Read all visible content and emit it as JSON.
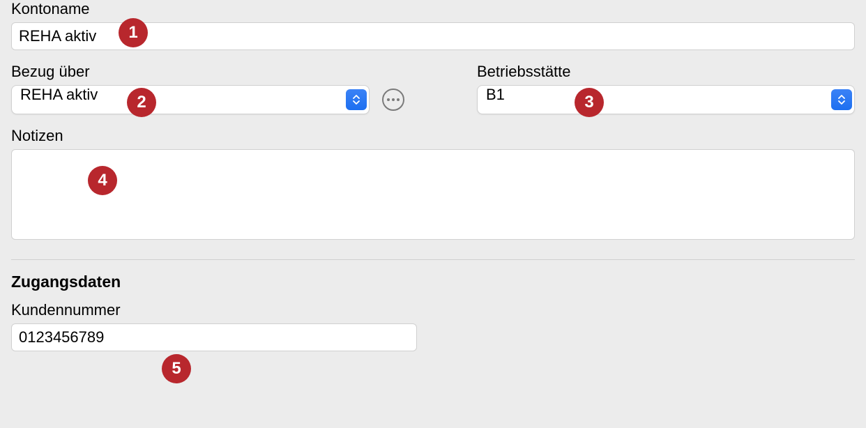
{
  "fields": {
    "kontoname": {
      "label": "Kontoname",
      "value": "REHA aktiv"
    },
    "bezug_ueber": {
      "label": "Bezug über",
      "value": "REHA aktiv"
    },
    "betriebsstaette": {
      "label": "Betriebsstätte",
      "value": "B1"
    },
    "notizen": {
      "label": "Notizen",
      "value": ""
    },
    "kundennummer": {
      "label": "Kundennummer",
      "value": "0123456789"
    }
  },
  "sections": {
    "zugangsdaten": "Zugangsdaten"
  },
  "badges": {
    "b1": "1",
    "b2": "2",
    "b3": "3",
    "b4": "4",
    "b5": "5"
  }
}
